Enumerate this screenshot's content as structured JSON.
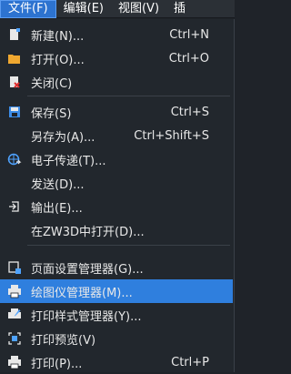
{
  "menubar": {
    "items": [
      {
        "label": "文件(F)"
      },
      {
        "label": "编辑(E)"
      },
      {
        "label": "视图(V)"
      },
      {
        "label": "插"
      }
    ]
  },
  "file_menu": {
    "new": {
      "label": "新建(N)...",
      "shortcut": "Ctrl+N"
    },
    "open": {
      "label": "打开(O)...",
      "shortcut": "Ctrl+O"
    },
    "close": {
      "label": "关闭(C)"
    },
    "save": {
      "label": "保存(S)",
      "shortcut": "Ctrl+S"
    },
    "save_as": {
      "label": "另存为(A)...",
      "shortcut": "Ctrl+Shift+S"
    },
    "email": {
      "label": "电子传递(T)..."
    },
    "send": {
      "label": "发送(D)..."
    },
    "export": {
      "label": "输出(E)..."
    },
    "open_in_zw3d": {
      "label": "在ZW3D中打开(D)..."
    },
    "page_setup": {
      "label": "页面设置管理器(G)..."
    },
    "plotter_manager": {
      "label": "绘图仪管理器(M)..."
    },
    "plot_style_manager": {
      "label": "打印样式管理器(Y)..."
    },
    "plot_preview": {
      "label": "打印预览(V)"
    },
    "plot": {
      "label": "打印(P)...",
      "shortcut": "Ctrl+P"
    }
  },
  "colors": {
    "background": "#22272d",
    "highlight": "#2f7fde",
    "active_menu": "#2d73d0"
  }
}
